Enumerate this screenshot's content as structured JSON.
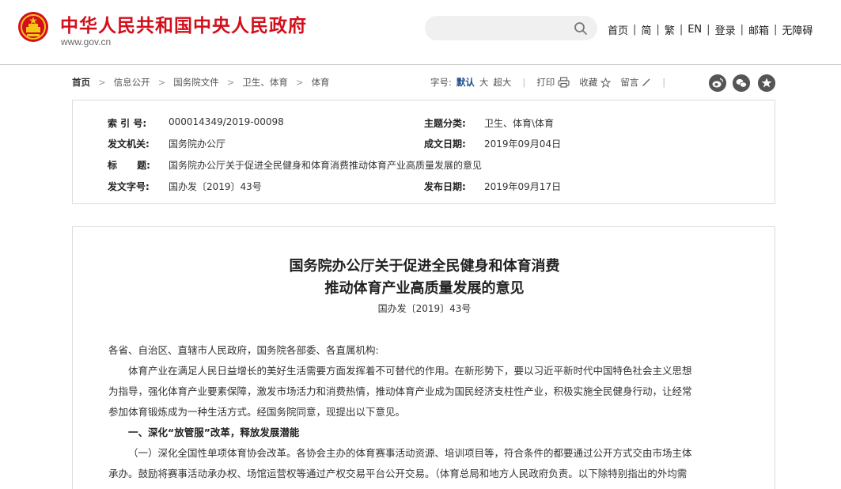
{
  "header": {
    "site_title": "中华人民共和国中央人民政府",
    "site_url": "www.gov.cn",
    "search_placeholder": "",
    "nav": [
      "首页",
      "简",
      "繁",
      "EN",
      "登录",
      "邮箱",
      "无障碍"
    ],
    "nav_separator": "|"
  },
  "breadcrumb": {
    "items": [
      "首页",
      "信息公开",
      "国务院文件",
      "卫生、体育",
      "体育"
    ],
    "arrow": ">"
  },
  "tools": {
    "font_label": "字号:",
    "font_default": "默认",
    "font_large": "大",
    "font_xlarge": "超大",
    "print": "打印",
    "favorite": "收藏",
    "comment": "留言",
    "separator": "|",
    "share_icons": [
      "weibo-icon",
      "wechat-icon",
      "star-icon"
    ]
  },
  "info": {
    "index_label": "索 引 号:",
    "index_value": "000014349/2019-00098",
    "topic_label": "主题分类:",
    "topic_value": "卫生、体育\\体育",
    "issuer_label": "发文机关:",
    "issuer_value": "国务院办公厅",
    "written_label": "成文日期:",
    "written_value": "2019年09月04日",
    "title_label": "标      题:",
    "title_value": "国务院办公厅关于促进全民健身和体育消费推动体育产业高质量发展的意见",
    "docno_label": "发文字号:",
    "docno_value": "国办发〔2019〕43号",
    "published_label": "发布日期:",
    "published_value": "2019年09月17日"
  },
  "article": {
    "title_line1": "国务院办公厅关于促进全民健身和体育消费",
    "title_line2": "推动体育产业高质量发展的意见",
    "doc_number": "国办发〔2019〕43号",
    "salutation": "各省、自治区、直辖市人民政府，国务院各部委、各直属机构:",
    "p1_line1": "体育产业在满足人民日益增长的美好生活需要方面发挥着不可替代的作用。在新形势下，要以习近平新时代中国特色社会主义思想",
    "p1_line2": "为指导，强化体育产业要素保障，激发市场活力和消费热情，推动体育产业成为国民经济支柱性产业，积极实施全民健身行动，让经常",
    "p1_line3": "参加体育锻炼成为一种生活方式。经国务院同意，现提出以下意见。",
    "section1": "一、深化“放管服”改革，释放发展潜能",
    "p2_line1": "（一）深化全国性单项体育协会改革。各协会主办的体育赛事活动资源、培训项目等，符合条件的都要通过公开方式交由市场主体",
    "p2_line2": "承办。鼓励将赛事活动承办权、场馆运营权等通过产权交易平台公开交易。（体育总局和地方人民政府负责。以下除特别指出的外均需"
  },
  "colors": {
    "brand_red": "#d30f1b",
    "active_blue": "#1a4c8d"
  }
}
